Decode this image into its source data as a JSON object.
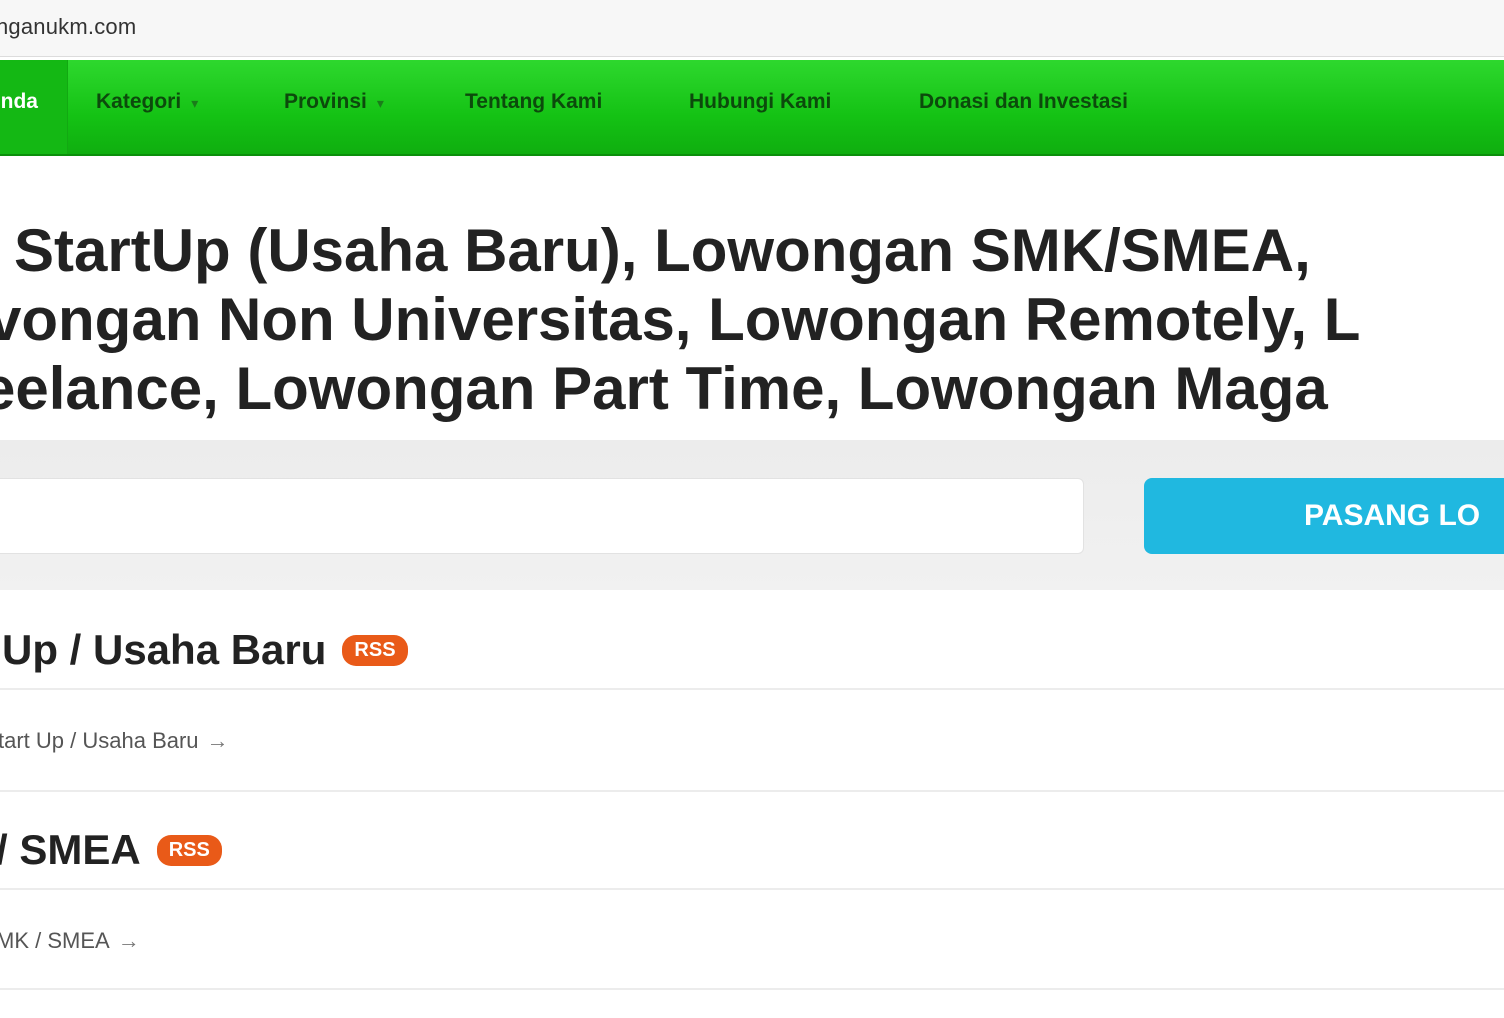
{
  "address_bar": {
    "url": "nganukm.com"
  },
  "nav": {
    "home_label": "nda",
    "items": [
      {
        "label": "Kategori",
        "has_caret": true
      },
      {
        "label": "Provinsi",
        "has_caret": true
      },
      {
        "label": "Tentang Kami",
        "has_caret": false
      },
      {
        "label": "Hubungi Kami",
        "has_caret": false
      },
      {
        "label": "Donasi dan Investasi",
        "has_caret": false
      }
    ]
  },
  "headline": {
    "line1": "StartUp (Usaha Baru), Lowongan SMK/SMEA,",
    "line2": "vongan Non Universitas, Lowongan Remotely, L",
    "line3": "eelance, Lowongan Part Time, Lowongan Maga"
  },
  "search": {
    "placeholder": "",
    "button_label": "PASANG LO"
  },
  "categories": [
    {
      "title": "Up / Usaha Baru",
      "badge": "RSS",
      "link": "tart Up / Usaha Baru",
      "arrow": "→"
    },
    {
      "title": "/ SMEA",
      "badge": "RSS",
      "link": "MK / SMEA",
      "arrow": "→"
    }
  ],
  "colors": {
    "nav_green": "#14c214",
    "button_blue": "#20b8e0",
    "rss_orange": "#e95a18"
  },
  "icons": {
    "caret": "chevron-down-icon",
    "arrow": "arrow-right-icon"
  }
}
